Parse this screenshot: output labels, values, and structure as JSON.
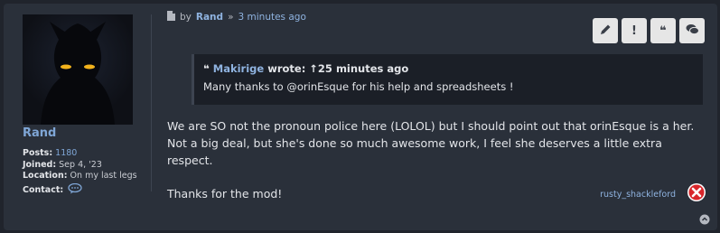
{
  "post": {
    "meta": {
      "by": "by",
      "author": "Rand",
      "separator": "»",
      "time": "3 minutes ago"
    },
    "quote": {
      "author": "Makirige",
      "wrote": "wrote:",
      "time": "↑25 minutes ago",
      "text": "Many thanks to @orinEsque for his help and spreadsheets !"
    },
    "content": [
      "We are SO not the pronoun police here (LOLOL) but I should point out that orinEsque is a her.",
      "Not a big deal, but she's done so much awesome work, I feel she deserves a little extra respect.",
      "Thanks for the mod!"
    ],
    "report_user": "rusty_shackleford"
  },
  "profile": {
    "username": "Rand",
    "posts_label": "Posts:",
    "posts_value": "1180",
    "joined_label": "Joined:",
    "joined_value": "Sep 4, '23",
    "location_label": "Location:",
    "location_value": "On my last legs",
    "contact_label": "Contact:"
  },
  "actions": [
    {
      "icon": "pencil-icon"
    },
    {
      "icon": "exclamation-icon",
      "label": "!"
    },
    {
      "icon": "quote-icon",
      "label": "❝"
    },
    {
      "icon": "comments-icon"
    }
  ],
  "colors": {
    "accent": "#8fb3e0",
    "report": "#d8262b"
  }
}
